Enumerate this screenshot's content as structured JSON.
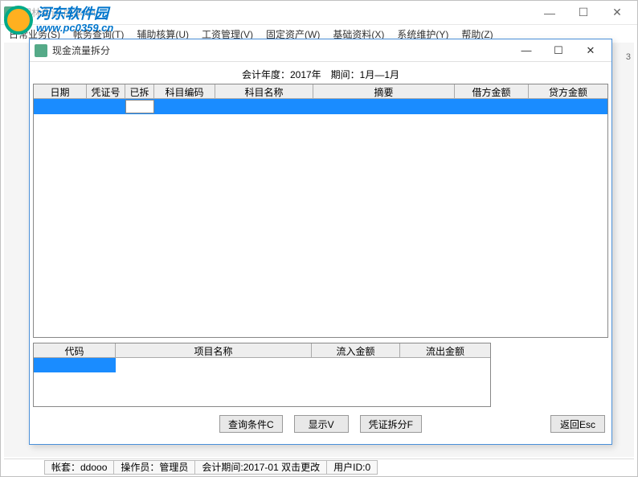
{
  "watermark": {
    "name": "河东软件园",
    "url": "www.pc0359.cn"
  },
  "outerWindow": {
    "title": "园林会计·版本:64"
  },
  "mainMenu": {
    "items": [
      {
        "label": "日常业务(S)"
      },
      {
        "label": "帐务查询(T)"
      },
      {
        "label": "辅助核算(U)"
      },
      {
        "label": "工资管理(V)"
      },
      {
        "label": "固定资产(W)"
      },
      {
        "label": "基础资料(X)"
      },
      {
        "label": "系统维护(Y)"
      },
      {
        "label": "帮助(Z)"
      }
    ]
  },
  "rightMarker": "3",
  "dialog": {
    "title": "现金流量拆分",
    "periodLabel": "会计年度：2017年　期间：1月—1月",
    "grid1": {
      "headers": [
        "日期",
        "凭证号",
        "已拆分",
        "科目编码",
        "科目名称",
        "摘要",
        "借方金额",
        "贷方金额"
      ]
    },
    "grid2": {
      "headers": [
        "代码",
        "项目名称",
        "流入金额",
        "流出金额"
      ]
    },
    "buttons": {
      "query": "查询条件C",
      "show": "显示V",
      "split": "凭证拆分F",
      "return": "返回Esc"
    }
  },
  "statusBar": {
    "account": "帐套：ddooo",
    "operator": "操作员：管理员",
    "period": "会计期间:2017-01 双击更改",
    "userId": "用户ID:0"
  }
}
